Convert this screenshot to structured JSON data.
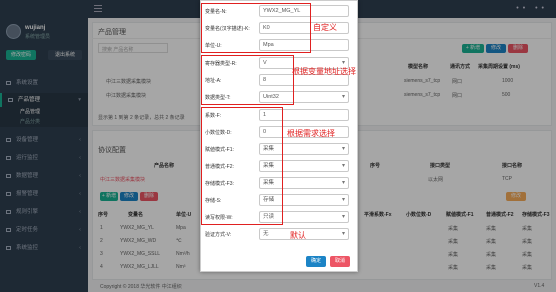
{
  "topbar": {
    "right": "•• ••"
  },
  "sidebar": {
    "user_name": "wujianj",
    "user_role": "系统管理员",
    "btn_a": "修改密码",
    "btn_b": "退出系统",
    "items": [
      {
        "label": "系统设置"
      },
      {
        "label": "产品管理"
      },
      {
        "label": "产品管理"
      },
      {
        "label": "产品分类"
      },
      {
        "label": "设备管理"
      },
      {
        "label": "运行监控"
      },
      {
        "label": "数据管理"
      },
      {
        "label": "报警管理"
      },
      {
        "label": "规则引擎"
      },
      {
        "label": "定时任务"
      },
      {
        "label": "系统监控"
      }
    ]
  },
  "main": {
    "title": "产品管理",
    "search_placeholder": "搜索 产品名称",
    "btn_add": "+ 新增",
    "btn_edit": "修改",
    "btn_del": "删除",
    "row1": "中江三数据采集模块",
    "row2": "中江数据采集模块",
    "col_model": "模型名称",
    "col_protocol": "通讯方式",
    "col_cycle": "采集周期设置 (ms)",
    "col_timeout": "采集超时设置 (ms)",
    "r1_model": "siemens_s7_tcp",
    "r1_protocol": "网口",
    "r1_cycle": "1000",
    "r2_model": "siemens_s7_tcp",
    "r2_protocol": "网口",
    "r2_cycle": "500",
    "pager": "显示第 1 到第 2 条记录，总共 2 条记录",
    "proto_title": "协议配置",
    "proto_col_name": "产品名称",
    "proto_col_id": "序号",
    "proto_col_if": "接口类型",
    "proto_col_ifname": "接口名称",
    "proto_val_if": "以太网",
    "proto_val_ifname": "TCP",
    "proto_row": "中江三数据采集模块",
    "var_col_no": "序号",
    "var_col_name": "变量名",
    "var_col_unit": "单位-U",
    "var_col_a": "平滑系数-Fx",
    "var_col_b": "小数位数-D",
    "var_col_c": "赋値模式-F1",
    "var_col_d": "普通模式-F2",
    "var_col_e": "存储模式-F3",
    "vars": [
      {
        "no": "1",
        "name": "YWX2_MG_YL",
        "unit": "Mpa"
      },
      {
        "no": "2",
        "name": "YWX2_MG_WD",
        "unit": "℃"
      },
      {
        "no": "3",
        "name": "YWX2_MG_SSLL",
        "unit": "Nm³/h"
      },
      {
        "no": "4",
        "name": "YWX2_MG_LJLL",
        "unit": "Nm³"
      }
    ],
    "var_cell": "采集",
    "footer": "Copyright © 2018 华光软件 中江组织",
    "version": "V1.4"
  },
  "modal": {
    "fields": [
      {
        "label": "变量名-N:",
        "value": "YWX2_MG_YL"
      },
      {
        "label": "变量名(汉字描述)-K:",
        "value": "K0"
      },
      {
        "label": "单位-U:",
        "value": "Mpa"
      },
      {
        "label": "寄存器类型-R:",
        "value": "V"
      },
      {
        "label": "地址-A:",
        "value": "8"
      },
      {
        "label": "数据类型-T:",
        "value": "Uint32"
      },
      {
        "label": "系数-F:",
        "value": "1"
      },
      {
        "label": "小数位数-D:",
        "value": "0"
      },
      {
        "label": "赋値模式-F1:",
        "value": "采集"
      },
      {
        "label": "普通模式-F2:",
        "value": "采集"
      },
      {
        "label": "存储模式-F3:",
        "value": "采集"
      },
      {
        "label": "存储-S:",
        "value": "存储"
      },
      {
        "label": "读写权限-W:",
        "value": "只读"
      },
      {
        "label": "验证方式-V:",
        "value": "无"
      }
    ],
    "ok": "确定",
    "cancel": "取消"
  },
  "annotations": {
    "a1": "自定义",
    "a2": "根据变量地址选择",
    "a3": "根据需求选择",
    "a4": "默认"
  }
}
